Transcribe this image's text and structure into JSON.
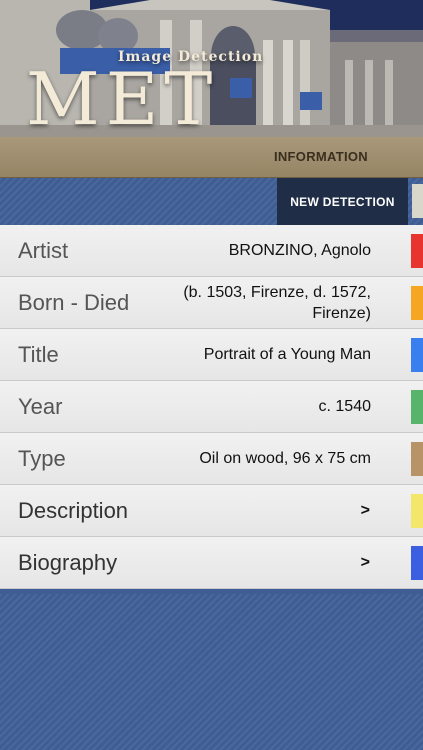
{
  "hero": {
    "subtitle": "Image Detection",
    "logo": "MET"
  },
  "info_bar": {
    "label": "INFORMATION"
  },
  "actions": {
    "new_detection": "NEW DETECTION"
  },
  "details": [
    {
      "key": "Artist",
      "value": "BRONZINO, Agnolo",
      "color": "#e8342f"
    },
    {
      "key": "Born - Died",
      "value": "(b. 1503, Firenze, d. 1572, Firenze)",
      "color": "#f5a623"
    },
    {
      "key": "Title",
      "value": "Portrait of a Young Man",
      "color": "#3a7ff0"
    },
    {
      "key": "Year",
      "value": "c. 1540",
      "color": "#58b36b"
    },
    {
      "key": "Type",
      "value": "Oil on wood, 96 x 75 cm",
      "color": "#b89368"
    },
    {
      "key": "Description",
      "value": ">",
      "color": "#f3e66a"
    },
    {
      "key": "Biography",
      "value": ">",
      "color": "#3b5fe0"
    }
  ]
}
